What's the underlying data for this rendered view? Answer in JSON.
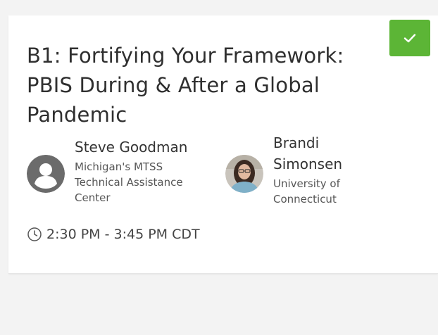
{
  "session": {
    "title": "B1: Fortifying Your Framework: PBIS During & After a Global Pandemic",
    "time": "2:30 PM - 3:45 PM CDT",
    "added": true
  },
  "speakers": [
    {
      "name": "Steve Goodman",
      "organization": "Michigan's MTSS Technical Assistance Center",
      "avatar": "placeholder-person-icon"
    },
    {
      "name": "Brandi Simonsen",
      "organization": "University of Connecticut",
      "avatar": "photo"
    }
  ],
  "icons": {
    "check": "check-icon",
    "clock": "clock-icon"
  },
  "colors": {
    "accent_green": "#5cb536",
    "avatar_gray": "#6b6b6b",
    "text": "#2f2f2f",
    "background": "#f3f3f3"
  }
}
